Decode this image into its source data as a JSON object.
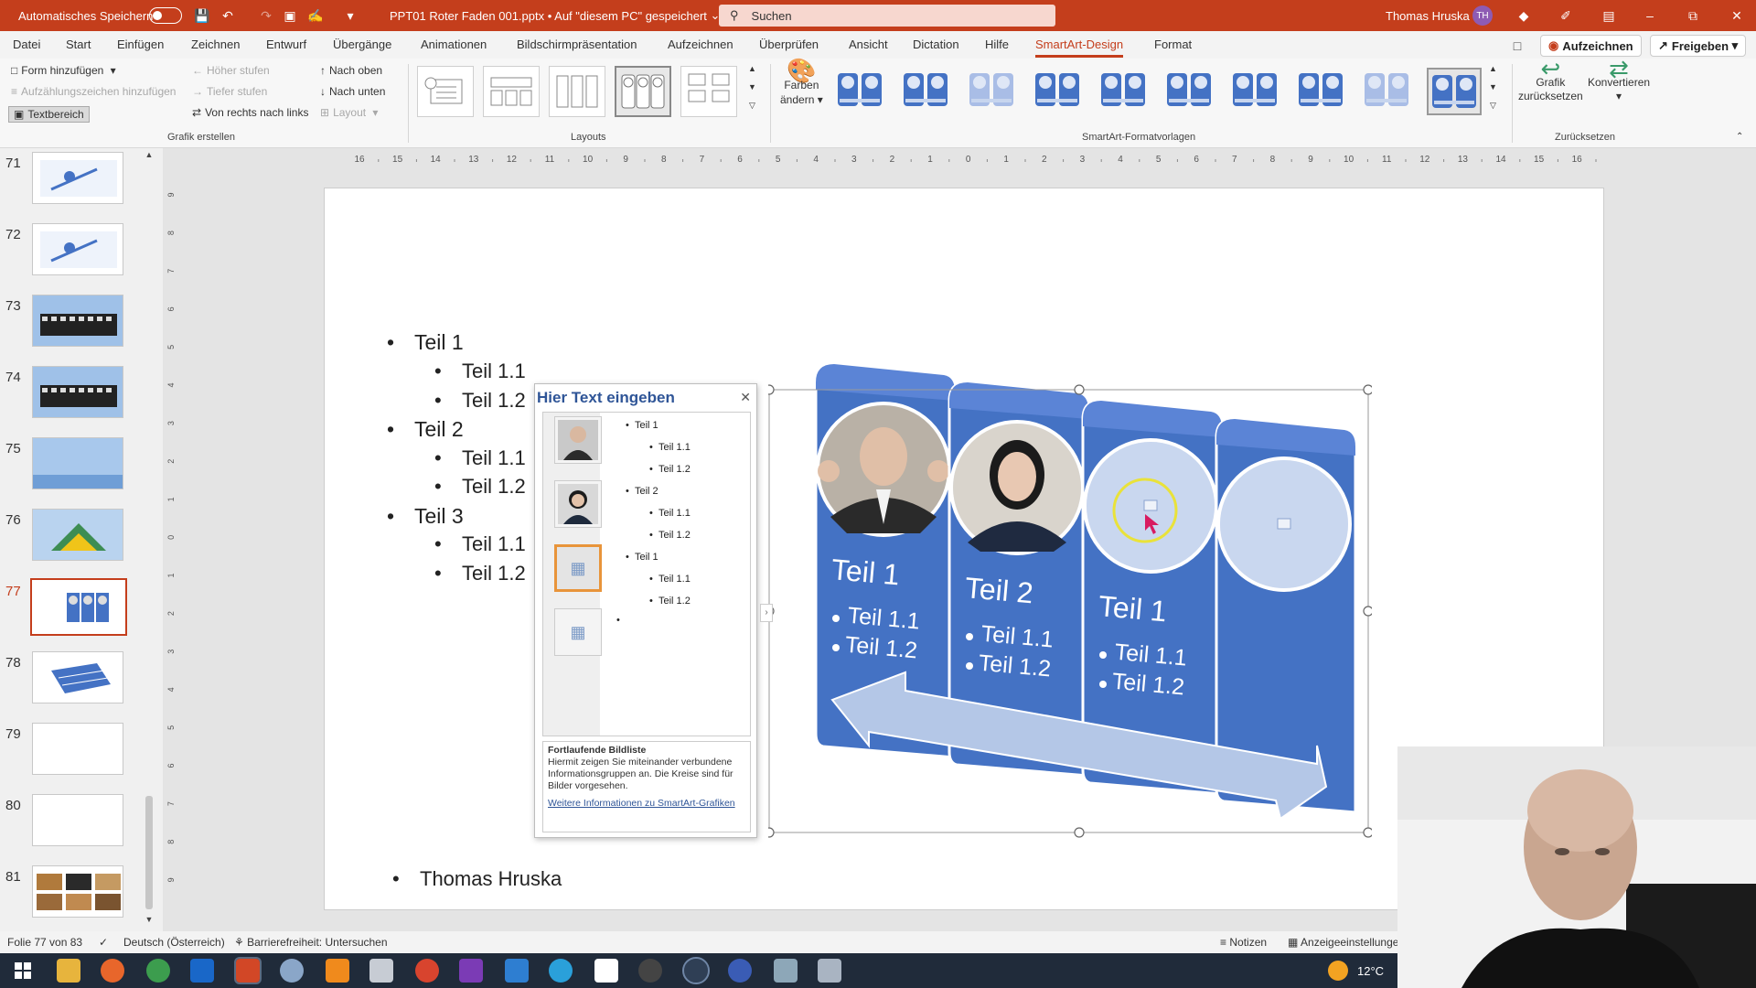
{
  "titlebar": {
    "autosave_label": "Automatisches Speichern",
    "document": "PPT01 Roter Faden 001.pptx • Auf \"diesem PC\" gespeichert",
    "search_placeholder": "Suchen",
    "user": "Thomas Hruska",
    "user_initials": "TH"
  },
  "menu": {
    "tabs": [
      "Datei",
      "Start",
      "Einfügen",
      "Zeichnen",
      "Entwurf",
      "Übergänge",
      "Animationen",
      "Bildschirmpräsentation",
      "Aufzeichnen",
      "Überprüfen",
      "Ansicht",
      "Dictation",
      "Hilfe",
      "SmartArt-Design",
      "Format"
    ],
    "active_tab": "SmartArt-Design",
    "record_button": "Aufzeichnen",
    "share_button": "Freigeben"
  },
  "ribbon": {
    "create": {
      "add_shape": "Form hinzufügen",
      "add_bullet": "Aufzählungszeichen hinzufügen",
      "text_pane": "Textbereich",
      "promote": "Höher stufen",
      "demote": "Tiefer stufen",
      "rtl": "Von rechts nach links",
      "move_up": "Nach oben",
      "move_down": "Nach unten",
      "layout": "Layout",
      "group": "Grafik erstellen"
    },
    "layouts_group": "Layouts",
    "change_colors_line1": "Farben",
    "change_colors_line2": "ändern",
    "styles_group": "SmartArt-Formatvorlagen",
    "reset_line1": "Grafik",
    "reset_line2": "zurücksetzen",
    "convert": "Konvertieren",
    "reset_group": "Zurücksetzen"
  },
  "slides": {
    "numbers": [
      "71",
      "72",
      "73",
      "74",
      "75",
      "76",
      "77",
      "78",
      "79",
      "80",
      "81"
    ],
    "current": "77"
  },
  "slide": {
    "bullets": [
      {
        "level": 1,
        "text": "Teil 1"
      },
      {
        "level": 2,
        "text": "Teil 1.1"
      },
      {
        "level": 2,
        "text": "Teil 1.2"
      },
      {
        "level": 1,
        "text": "Teil 2"
      },
      {
        "level": 2,
        "text": "Teil 1.1"
      },
      {
        "level": 2,
        "text": "Teil 1.2"
      },
      {
        "level": 1,
        "text": "Teil 3"
      },
      {
        "level": 2,
        "text": "Teil 1.1"
      },
      {
        "level": 2,
        "text": "Teil 1.2"
      }
    ],
    "footer_name": "Thomas Hruska"
  },
  "text_pane": {
    "title": "Hier Text eingeben",
    "items": [
      {
        "level": 1,
        "text": "Teil 1"
      },
      {
        "level": 2,
        "text": "Teil 1.1"
      },
      {
        "level": 2,
        "text": "Teil 1.2"
      },
      {
        "level": 1,
        "text": "Teil 2"
      },
      {
        "level": 2,
        "text": "Teil 1.1"
      },
      {
        "level": 2,
        "text": "Teil 1.2"
      },
      {
        "level": 1,
        "text": "Teil 1"
      },
      {
        "level": 2,
        "text": "Teil 1.1"
      },
      {
        "level": 2,
        "text": "Teil 1.2"
      }
    ],
    "desc_title": "Fortlaufende Bildliste",
    "desc_text": "Hiermit zeigen Sie miteinander verbundene Informationsgruppen an. Die Kreise sind für Bilder vorgesehen.",
    "desc_link": "Weitere Informationen zu SmartArt-Grafiken"
  },
  "smartart": {
    "panels": [
      {
        "title": "Teil 1",
        "sub1": "Teil 1.1",
        "sub2": "Teil 1.2",
        "photo": "man"
      },
      {
        "title": "Teil 2",
        "sub1": "Teil 1.1",
        "sub2": "Teil 1.2",
        "photo": "woman"
      },
      {
        "title": "Teil 1",
        "sub1": "Teil 1.1",
        "sub2": "Teil 1.2",
        "photo": "placeholder"
      },
      {
        "title": "",
        "sub1": "",
        "sub2": "",
        "photo": "placeholder"
      }
    ],
    "colors": {
      "panel": "#4472c4",
      "panel_top": "#5b84d6",
      "arrow": "#b4c7e7"
    }
  },
  "statusbar": {
    "slide_info": "Folie 77 von 83",
    "language": "Deutsch (Österreich)",
    "accessibility": "Barrierefreiheit: Untersuchen",
    "notes": "Notizen",
    "display_settings": "Anzeigeeinstellunge"
  },
  "taskbar": {
    "temperature": "12°C"
  }
}
